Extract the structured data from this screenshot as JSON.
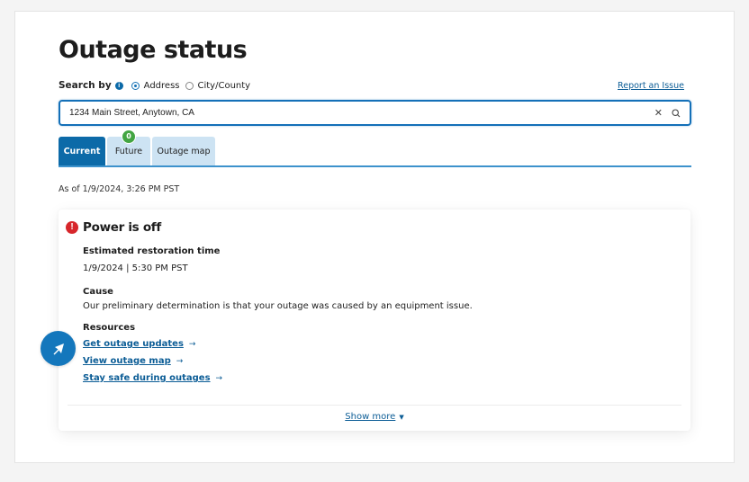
{
  "page": {
    "title": "Outage status"
  },
  "search": {
    "label": "Search by",
    "info_icon": "info-icon",
    "options": [
      {
        "label": "Address",
        "selected": true
      },
      {
        "label": "City/County",
        "selected": false
      }
    ],
    "value": "1234 Main Street, Anytown, CA",
    "report_link": "Report an Issue"
  },
  "tabs": [
    {
      "label": "Current",
      "active": true
    },
    {
      "label": "Future",
      "active": false,
      "badge": "0"
    },
    {
      "label": "Outage map",
      "active": false
    }
  ],
  "as_of": "As of 1/9/2024, 3:26 PM PST",
  "status": {
    "title": "Power is off",
    "icon": "alert-icon",
    "restoration_label": "Estimated restoration time",
    "restoration_value": "1/9/2024 | 5:30 PM PST",
    "cause_label": "Cause",
    "cause_value": "Our preliminary determination is that your outage was caused by an equipment issue.",
    "resources_label": "Resources",
    "resources": [
      {
        "label": "Get outage updates"
      },
      {
        "label": "View outage map"
      },
      {
        "label": "Stay safe during outages"
      }
    ],
    "show_more": "Show more"
  },
  "colors": {
    "brand_blue": "#0c6aa8",
    "link_blue": "#0c5d96",
    "alert_red": "#d7262b",
    "badge_green": "#43a543",
    "tab_inactive": "#cde3f3"
  }
}
